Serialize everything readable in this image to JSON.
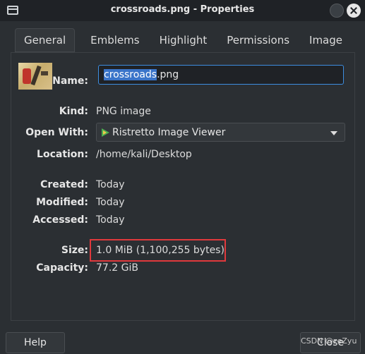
{
  "window": {
    "title": "crossroads.png - Properties"
  },
  "tabs": [
    {
      "label": "General"
    },
    {
      "label": "Emblems"
    },
    {
      "label": "Highlight"
    },
    {
      "label": "Permissions"
    },
    {
      "label": "Image"
    }
  ],
  "active_tab": "General",
  "general": {
    "name_label": "Name:",
    "name_selected": "crossroads",
    "name_ext": ".png",
    "kind_label": "Kind:",
    "kind_value": "PNG image",
    "open_with_label": "Open With:",
    "open_with_value": "Ristretto Image Viewer",
    "location_label": "Location:",
    "location_value": "/home/kali/Desktop",
    "created_label": "Created:",
    "created_value": "Today",
    "modified_label": "Modified:",
    "modified_value": "Today",
    "accessed_label": "Accessed:",
    "accessed_value": "Today",
    "size_label": "Size:",
    "size_value": "1.0 MiB (1,100,255 bytes)",
    "capacity_label": "Capacity:",
    "capacity_value": "77.2 GiB"
  },
  "buttons": {
    "help": "Help",
    "close": "Close"
  },
  "watermark": "CSDN @zeZyu",
  "colors": {
    "background": "#2b2f33",
    "selection": "#3a74c9",
    "annotation_box": "#e0393c",
    "input_focus": "#3d8ee0"
  }
}
